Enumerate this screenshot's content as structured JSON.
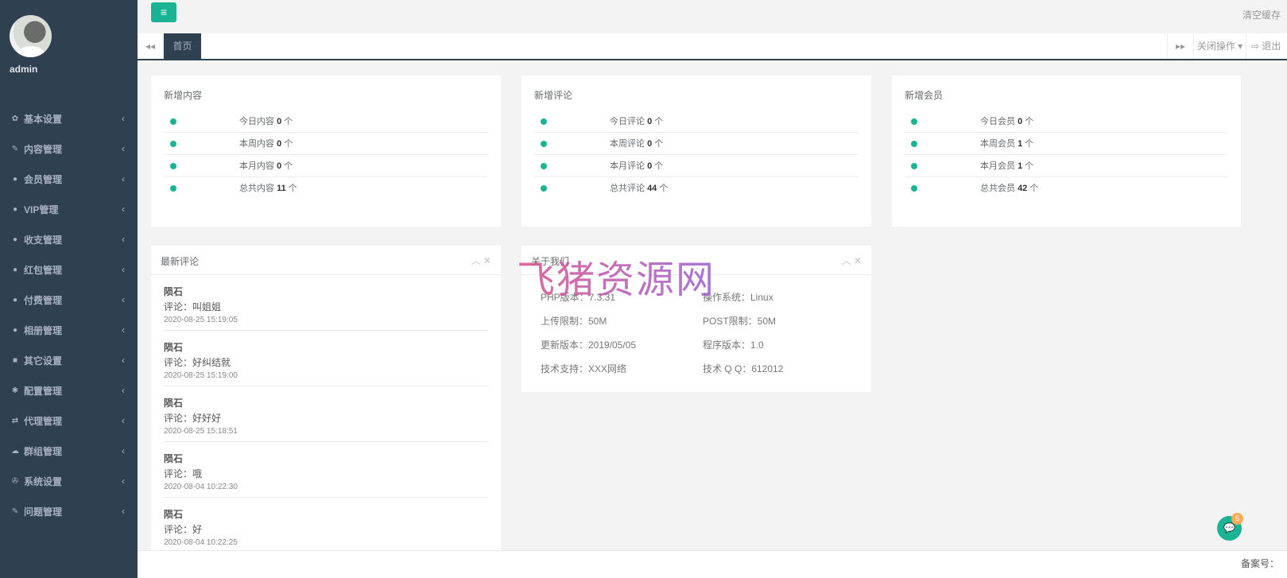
{
  "user": {
    "name": "admin"
  },
  "sidebar": {
    "items": [
      {
        "label": "基本设置",
        "icon": "gear-icon",
        "glyph": "✿"
      },
      {
        "label": "内容管理",
        "icon": "edit-icon",
        "glyph": "✎"
      },
      {
        "label": "会员管理",
        "icon": "user-icon",
        "glyph": "●"
      },
      {
        "label": "VIP管理",
        "icon": "user-icon",
        "glyph": "●"
      },
      {
        "label": "收支管理",
        "icon": "user-icon",
        "glyph": "●"
      },
      {
        "label": "红包管理",
        "icon": "user-icon",
        "glyph": "●"
      },
      {
        "label": "付费管理",
        "icon": "user-icon",
        "glyph": "●"
      },
      {
        "label": "相册管理",
        "icon": "user-icon",
        "glyph": "●"
      },
      {
        "label": "其它设置",
        "icon": "book-icon",
        "glyph": "■"
      },
      {
        "label": "配置管理",
        "icon": "asterisk-icon",
        "glyph": "✱"
      },
      {
        "label": "代理管理",
        "icon": "exchange-icon",
        "glyph": "⇄"
      },
      {
        "label": "群组管理",
        "icon": "comment-icon",
        "glyph": "☁"
      },
      {
        "label": "系统设置",
        "icon": "cogs-icon",
        "glyph": "✇"
      },
      {
        "label": "问题管理",
        "icon": "edit-icon",
        "glyph": "✎"
      }
    ]
  },
  "topbar": {
    "menu_glyph": "≡",
    "clear_cache": "清空缓存"
  },
  "tabs": {
    "home": "首页",
    "prev_glyph": "◂◂",
    "next_glyph": "▸▸",
    "close_ops": "关闭操作 ▾",
    "logout": "⇨ 退出"
  },
  "stats": [
    {
      "title": "新增内容",
      "rows": [
        {
          "label": "今日内容",
          "value": "0",
          "unit": "个"
        },
        {
          "label": "本周内容",
          "value": "0",
          "unit": "个"
        },
        {
          "label": "本月内容",
          "value": "0",
          "unit": "个"
        },
        {
          "label": "总共内容",
          "value": "11",
          "unit": "个"
        }
      ]
    },
    {
      "title": "新增评论",
      "rows": [
        {
          "label": "今日评论",
          "value": "0",
          "unit": "个"
        },
        {
          "label": "本周评论",
          "value": "0",
          "unit": "个"
        },
        {
          "label": "本月评论",
          "value": "0",
          "unit": "个"
        },
        {
          "label": "总共评论",
          "value": "44",
          "unit": "个"
        }
      ]
    },
    {
      "title": "新增会员",
      "rows": [
        {
          "label": "今日会员",
          "value": "0",
          "unit": "个"
        },
        {
          "label": "本周会员",
          "value": "1",
          "unit": "个"
        },
        {
          "label": "本月会员",
          "value": "1",
          "unit": "个"
        },
        {
          "label": "总共会员",
          "value": "42",
          "unit": "个"
        }
      ]
    }
  ],
  "comments": {
    "title": "最新评论",
    "items": [
      {
        "name": "陨石",
        "text": "评论：叫姐姐",
        "time": "2020-08-25 15:19:05"
      },
      {
        "name": "陨石",
        "text": "评论：好纠结就",
        "time": "2020-08-25 15:19:00"
      },
      {
        "name": "陨石",
        "text": "评论：好好好",
        "time": "2020-08-25 15:18:51"
      },
      {
        "name": "陨石",
        "text": "评论：哦",
        "time": "2020-08-04 10:22:30"
      },
      {
        "name": "陨石",
        "text": "评论：好",
        "time": "2020-08-04 10:22:25"
      }
    ]
  },
  "about": {
    "title": "关于我们",
    "rows": [
      [
        "PHP版本：7.3.31",
        "操作系统：Linux"
      ],
      [
        "上传限制：50M",
        "POST限制：50M"
      ],
      [
        "更新版本：2019/05/05",
        "程序版本：1.0"
      ],
      [
        "技术支持：XXX网络",
        "技术 Q Q：612012"
      ]
    ]
  },
  "watermark": "飞猪资源网",
  "chat": {
    "badge": "5"
  },
  "footer": {
    "text": "备案号："
  },
  "colors": {
    "sidebar": "#2f4050",
    "accent": "#1ab394",
    "badge": "#f8ac59"
  }
}
